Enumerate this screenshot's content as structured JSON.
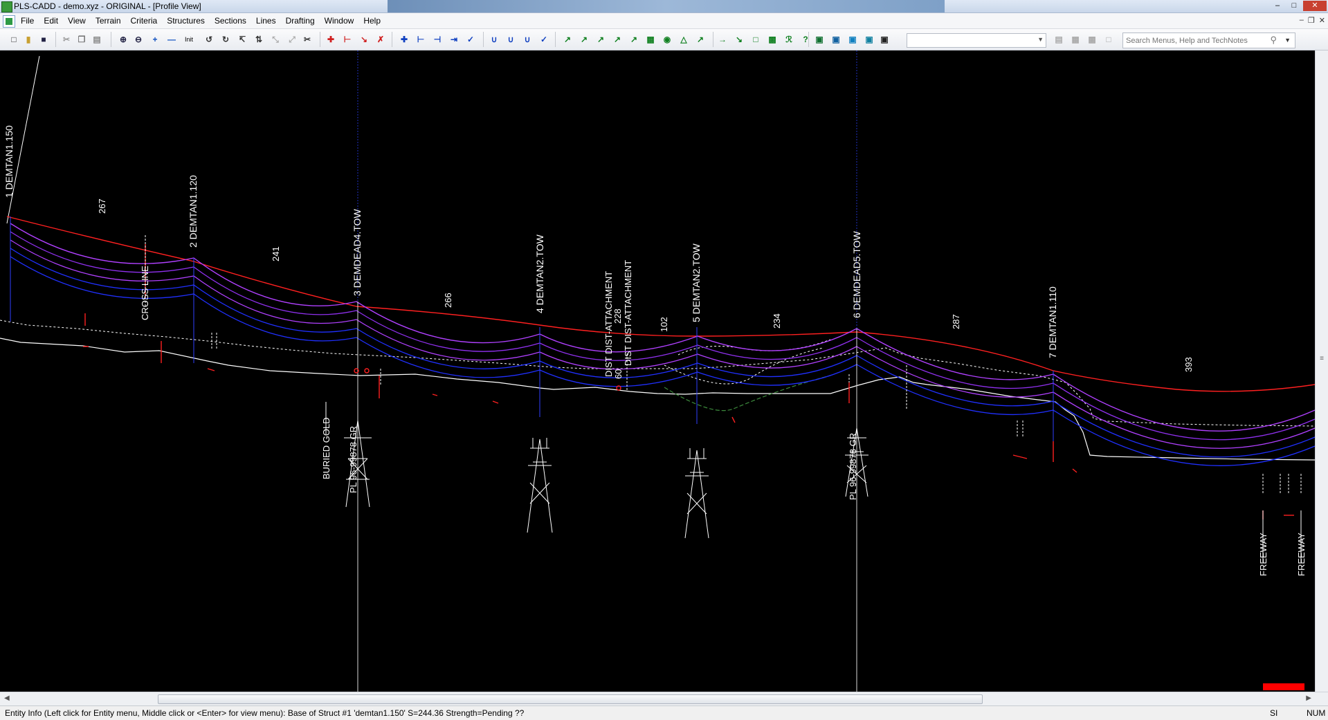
{
  "window": {
    "title": "PLS-CADD - demo.xyz - ORIGINAL - [Profile View]"
  },
  "menu": {
    "items": [
      "File",
      "Edit",
      "View",
      "Terrain",
      "Criteria",
      "Structures",
      "Sections",
      "Lines",
      "Drafting",
      "Window",
      "Help"
    ]
  },
  "search": {
    "placeholder": "Search Menus, Help and TechNotes"
  },
  "colors": {
    "background": "#000000",
    "ground": "#ffffff",
    "clearance": "#ff2020",
    "wire_purple": "#b040ff",
    "wire_blue": "#2030ff",
    "structure_line": "#3040ff",
    "alert": "#ff0000"
  },
  "toolbar_icons": [
    "new-icon",
    "open-icon",
    "save-icon",
    "cut-icon",
    "copy-icon",
    "paste-icon",
    "zoom-in-icon",
    "zoom-out-icon",
    "pan-icon",
    "zoom-extent-icon",
    "init-icon"
  ],
  "toolbar": {
    "init_label": "Init"
  },
  "profile": {
    "structures": [
      {
        "label": "1 DEMTAN1.150"
      },
      {
        "label": "2 DEMTAN1.120"
      },
      {
        "label": "3 DEMDEAD4.TOW"
      },
      {
        "label": "4 DEMTAN2.TOW"
      },
      {
        "label": "5 DEMTAN2.TOW"
      },
      {
        "label": "6 DEMDEAD5.TOW"
      },
      {
        "label": "7 DEMTAN1.110"
      }
    ],
    "spans": [
      "267",
      "241",
      "266",
      "228",
      "102",
      "234",
      "287",
      "393"
    ],
    "annotations": {
      "crossline": "CROSS LINE",
      "dist1": "DIST DIST-ATTACHMENT",
      "dist2": "DIST DIST-ATTACHMENT",
      "dist_num": "60",
      "buried_gold": "BURIED GOLD",
      "pl_gr_1": "PL 96-99878 GR",
      "pl_gr_2": "PL 96-99878 GR",
      "freeway1": "FREEWAY",
      "freeway2": "FREEWAY"
    }
  },
  "status": {
    "message": "Entity Info (Left click for Entity menu, Middle click or <Enter> for view menu):  Base of Struct #1 'demtan1.150' S=244.36 Strength=Pending  ??",
    "units": "SI",
    "numlock": "NUM"
  }
}
